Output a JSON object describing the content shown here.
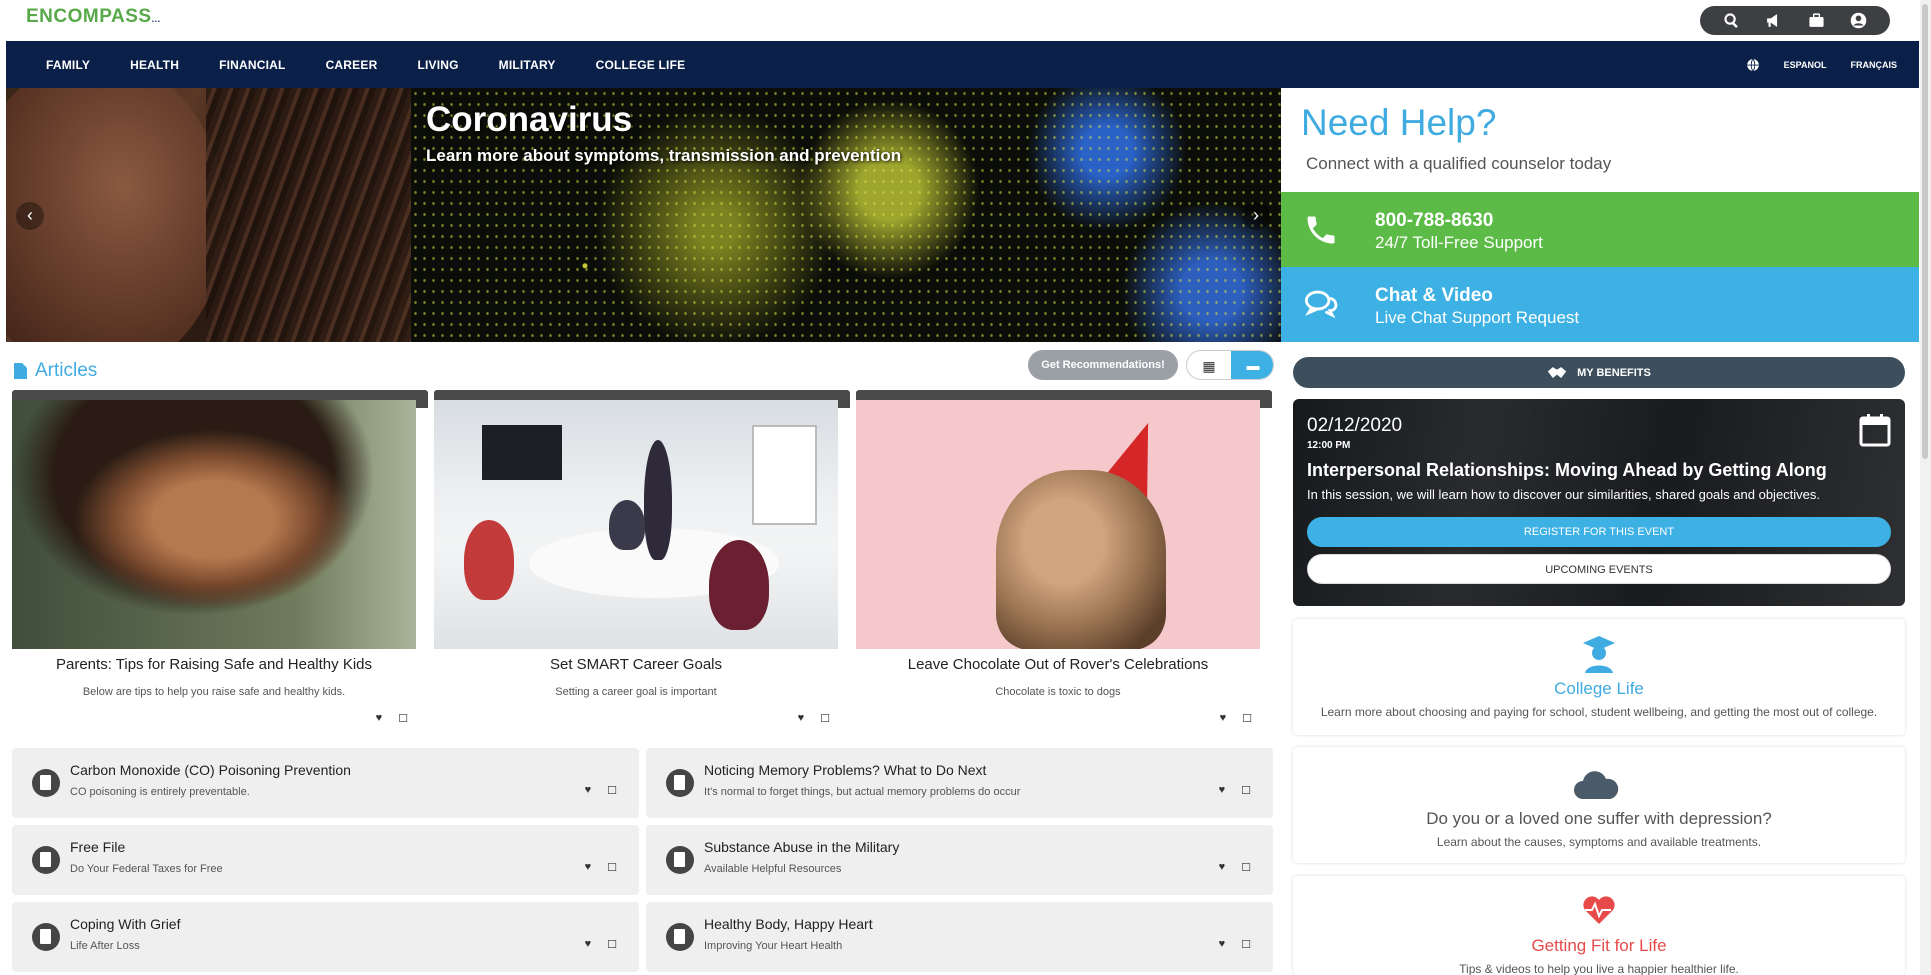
{
  "brand": {
    "logo": "ENCOMPASS",
    "logo_suffix": "..."
  },
  "utility_icons": [
    "search-icon",
    "megaphone-icon",
    "briefcase-icon",
    "user-icon"
  ],
  "nav": {
    "items": [
      "FAMILY",
      "HEALTH",
      "FINANCIAL",
      "CAREER",
      "LIVING",
      "MILITARY",
      "COLLEGE LIFE"
    ],
    "languages": [
      "ESPANOL",
      "FRANÇAIS"
    ]
  },
  "hero": {
    "title": "Coronavirus",
    "subtitle": "Learn more about symptoms, transmission and prevention",
    "prev": "‹",
    "next": "›"
  },
  "help": {
    "title": "Need Help?",
    "subtitle": "Connect with a qualified counselor today",
    "phone": {
      "number": "800-788-8630",
      "label": "24/7 Toll-Free Support"
    },
    "chat": {
      "title": "Chat & Video",
      "label": "Live Chat Support Request"
    }
  },
  "articles": {
    "heading": "Articles",
    "recommend_label": "Get Recommendations!",
    "cards": [
      {
        "title": "Parents: Tips for Raising Safe and Healthy Kids",
        "desc": "Below are tips to help you raise safe and healthy kids."
      },
      {
        "title": "Set SMART Career Goals",
        "desc": "Setting a career goal is important"
      },
      {
        "title": "Leave Chocolate Out of Rover's Celebrations",
        "desc": "Chocolate is toxic to dogs"
      }
    ],
    "list": [
      {
        "title": "Carbon Monoxide (CO) Poisoning Prevention",
        "desc": "CO poisoning is entirely preventable."
      },
      {
        "title": "Noticing Memory Problems? What to Do Next",
        "desc": "It's normal to forget things, but actual memory problems do occur"
      },
      {
        "title": "Free File",
        "desc": "Do Your Federal Taxes for Free"
      },
      {
        "title": "Substance Abuse in the Military",
        "desc": "Available Helpful Resources"
      },
      {
        "title": "Coping With Grief",
        "desc": "Life After Loss"
      },
      {
        "title": "Healthy Body, Happy Heart",
        "desc": "Improving Your Heart Health"
      }
    ]
  },
  "benefits": {
    "label": "MY BENEFITS"
  },
  "event": {
    "date": "02/12/2020",
    "time": "12:00 PM",
    "title": "Interpersonal Relationships: Moving Ahead by Getting Along",
    "desc": "In this session, we will learn how to discover our similarities, shared goals and objectives.",
    "register": "REGISTER FOR THIS EVENT",
    "upcoming": "UPCOMING EVENTS"
  },
  "promos": [
    {
      "title": "College Life",
      "desc": "Learn more about choosing and paying for school, student wellbeing, and getting the most out of college.",
      "color": "#40abe0",
      "icon": "graduate-icon"
    },
    {
      "title": "Do you or a loved one suffer with depression?",
      "desc": "Learn about the causes, symptoms and available treatments.",
      "color": "#555555",
      "icon": "cloud-icon"
    },
    {
      "title": "Getting Fit for Life",
      "desc": "Tips & videos to help you live a happier healthier life.",
      "color": "#e84a4a",
      "icon": "heartbeat-icon"
    }
  ],
  "colors": {
    "nav": "#0b2049",
    "accent": "#3eb1e4",
    "green": "#5cbb46",
    "brand_green": "#58a94a"
  }
}
